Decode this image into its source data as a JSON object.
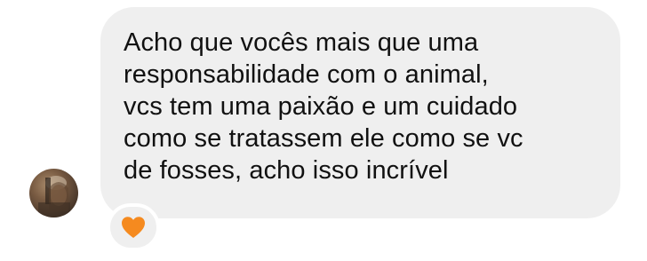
{
  "message": {
    "lines": [
      "Acho que vocês mais que uma",
      "responsabilidade com o animal,",
      "vcs tem uma paixão e um cuidado",
      "como se tratassem ele como se vc",
      "de fosses, acho isso incrível"
    ]
  },
  "reaction": {
    "icon": "orange-heart-icon",
    "color": "#F58A1F"
  },
  "colors": {
    "bubble": "#EFEFEF",
    "text": "#111111",
    "background": "#FFFFFF"
  }
}
